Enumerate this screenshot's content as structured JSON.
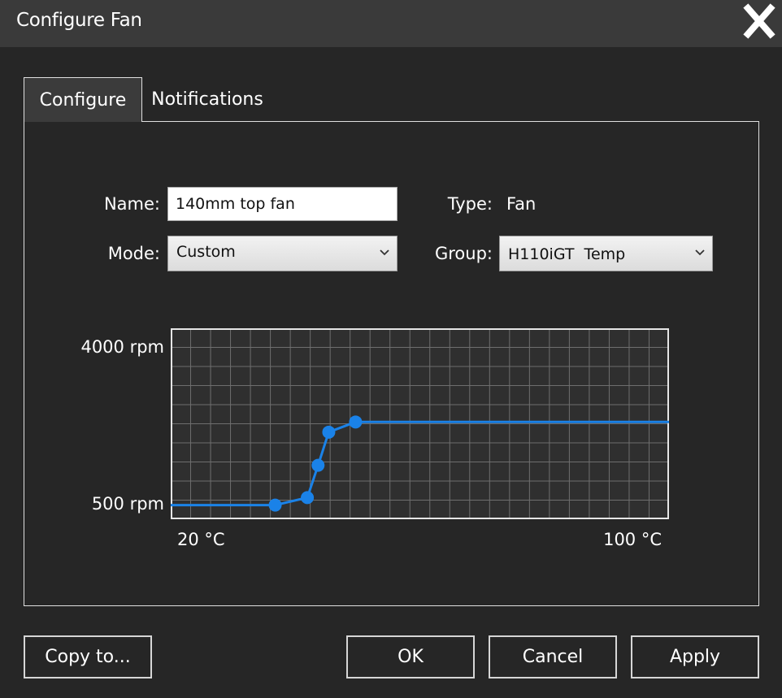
{
  "window": {
    "title": "Configure Fan",
    "close_icon": "close-icon"
  },
  "tabs": [
    {
      "label": "Configure",
      "active": true
    },
    {
      "label": "Notifications",
      "active": false
    }
  ],
  "form": {
    "name_label": "Name:",
    "name_value": "140mm top fan",
    "type_label": "Type:",
    "type_value": "Fan",
    "mode_label": "Mode:",
    "mode_value": "Custom",
    "group_label": "Group:",
    "group_value": "H110iGT  Temp"
  },
  "chart_data": {
    "type": "line",
    "y_top_label": "4000 rpm",
    "y_bottom_label": "500 rpm",
    "x_left_label": "20 °C",
    "x_right_label": "100 °C",
    "xlim": [
      20,
      100
    ],
    "ylim": [
      500,
      4000
    ],
    "x_extent": [
      11,
      104
    ],
    "y_extent": [
      180,
      4500
    ],
    "grid": true,
    "line_color": "#1a82e8",
    "points": [
      {
        "x": 30.5,
        "y": 500
      },
      {
        "x": 36.5,
        "y": 670
      },
      {
        "x": 38.5,
        "y": 1400
      },
      {
        "x": 40.5,
        "y": 2150
      },
      {
        "x": 45.5,
        "y": 2380
      }
    ],
    "flat_left_y": 500,
    "flat_right_y": 2380
  },
  "buttons": {
    "copy_label": "Copy to...",
    "ok_label": "OK",
    "cancel_label": "Cancel",
    "apply_label": "Apply"
  },
  "colors": {
    "accent": "#1a82e8",
    "titlebar": "#3a3a3a",
    "background": "#262626"
  }
}
